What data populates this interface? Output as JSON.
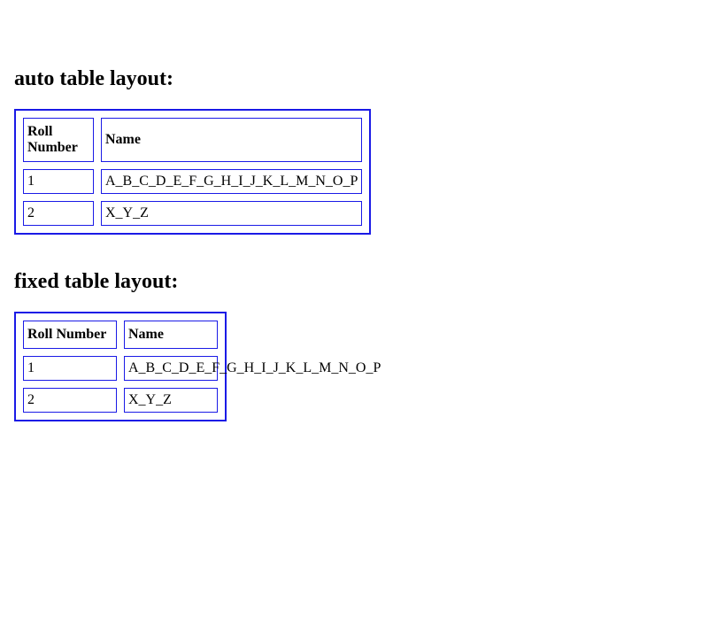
{
  "section1": {
    "heading": "auto table layout:",
    "headers": {
      "col1": "Roll Number",
      "col2": "Name"
    },
    "rows": [
      {
        "col1": "1",
        "col2": "A_B_C_D_E_F_G_H_I_J_K_L_M_N_O_P"
      },
      {
        "col1": "2",
        "col2": "X_Y_Z"
      }
    ]
  },
  "section2": {
    "heading": "fixed table layout:",
    "headers": {
      "col1": "Roll Number",
      "col2": "Name"
    },
    "rows": [
      {
        "col1": "1",
        "col2": "A_B_C_D_E_F_G_H_I_J_K_L_M_N_O_P"
      },
      {
        "col1": "2",
        "col2": "X_Y_Z"
      }
    ]
  }
}
